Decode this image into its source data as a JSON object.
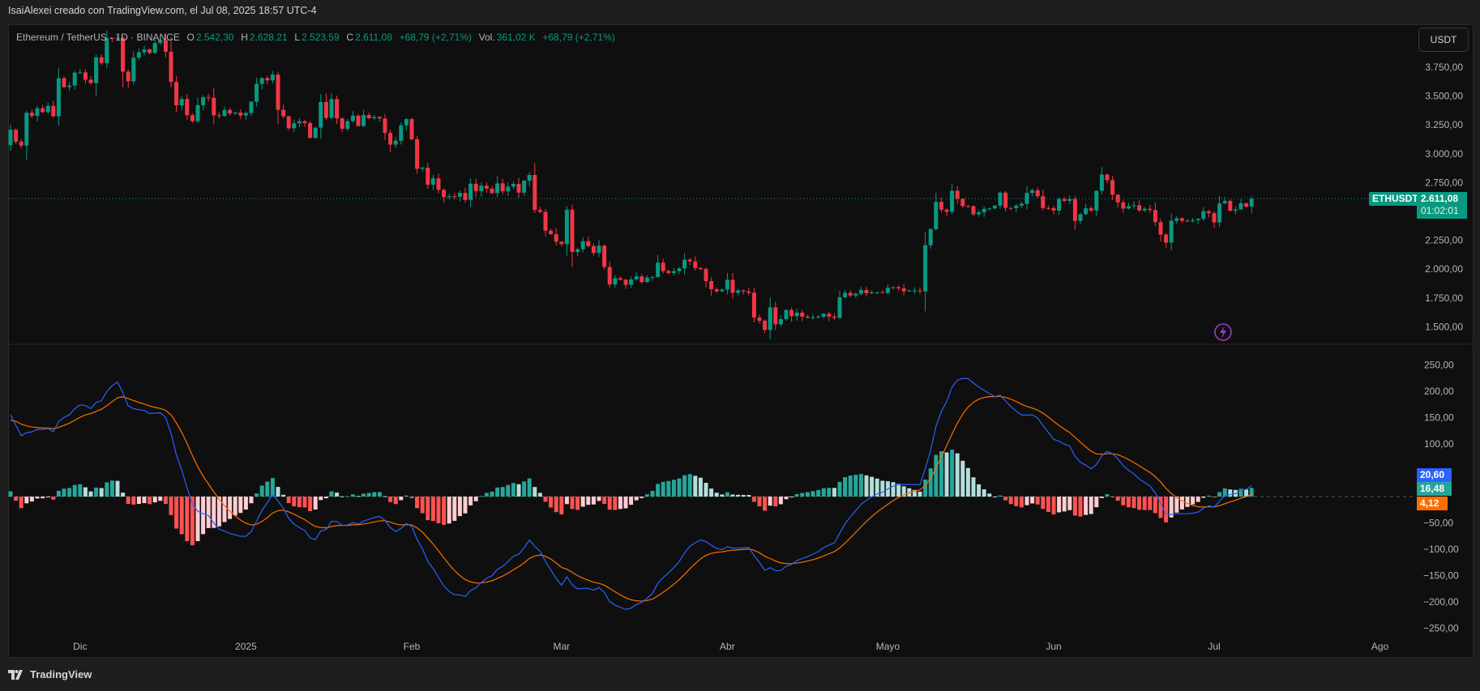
{
  "header": {
    "attribution": "IsaiAlexei creado con TradingView.com, el Jul 08, 2025 18:57 UTC-4"
  },
  "legend": {
    "symbol": "Ethereum / TetherUS · 1D · BINANCE",
    "open_label": "O",
    "open": "2.542,30",
    "high_label": "H",
    "high": "2.628,21",
    "low_label": "L",
    "low": "2.523,59",
    "close_label": "C",
    "close": "2.611,08",
    "change": "+68,79 (+2,71%)",
    "vol_label": "Vol.",
    "volume": "361,02 K",
    "vol_change": "+68,79 (+2,71%)"
  },
  "currency_button": "USDT",
  "price_tag": {
    "symbol": "ETHUSDT",
    "price": "2.611,08",
    "countdown": "01:02:01"
  },
  "macd_tags": {
    "macd": "20,60",
    "histogram": "16,48",
    "signal": "4,12"
  },
  "footer": {
    "brand": "TradingView"
  },
  "colors": {
    "up": "#089981",
    "down": "#f23645",
    "macd": "#2962ff",
    "signal": "#ff6d00",
    "hist_up": "#26a69a",
    "hist_up_fade": "#b2dfdb",
    "hist_down": "#ff5252",
    "hist_down_fade": "#ffcdd2",
    "alert": "#9c3dbf"
  },
  "chart_data": {
    "type": "candlestick",
    "title": "Ethereum / TetherUS · 1D · BINANCE",
    "start_date": "2024-11-18",
    "price_axis": {
      "ticks": [
        "3.750,00",
        "3.500,00",
        "3.250,00",
        "3.000,00",
        "2.750,00",
        "2.250,00",
        "2.000,00",
        "1.750,00",
        "1.500,00"
      ],
      "tick_values": [
        3750,
        3500,
        3250,
        3000,
        2750,
        2250,
        2000,
        1750,
        1500
      ]
    },
    "macd_axis": {
      "ticks": [
        "250,00",
        "200,00",
        "150,00",
        "100,00",
        "-50,00",
        "-100,00",
        "-150,00",
        "-200,00",
        "-250,00"
      ],
      "tick_values": [
        250,
        200,
        150,
        100,
        -50,
        -100,
        -150,
        -200,
        -250
      ]
    },
    "time_axis": [
      {
        "label": "Dic",
        "day": 13
      },
      {
        "label": "2025",
        "day": 44
      },
      {
        "label": "Feb",
        "day": 75
      },
      {
        "label": "Mar",
        "day": 103
      },
      {
        "label": "Abr",
        "day": 134
      },
      {
        "label": "Mayo",
        "day": 164
      },
      {
        "label": "Jun",
        "day": 195
      },
      {
        "label": "Jul",
        "day": 225
      },
      {
        "label": "Ago",
        "day": 256
      }
    ],
    "first_open": 3075,
    "closes": [
      3208,
      3105,
      3071,
      3356,
      3328,
      3395,
      3361,
      3415,
      3325,
      3655,
      3578,
      3591,
      3703,
      3706,
      3642,
      3613,
      3836,
      3786,
      4002,
      3996,
      4004,
      3712,
      3628,
      3833,
      3880,
      3905,
      3874,
      3960,
      3986,
      3884,
      3623,
      3420,
      3475,
      3334,
      3282,
      3421,
      3489,
      3485,
      3333,
      3327,
      3380,
      3349,
      3357,
      3332,
      3353,
      3451,
      3606,
      3656,
      3636,
      3686,
      3381,
      3325,
      3221,
      3264,
      3282,
      3266,
      3138,
      3226,
      3449,
      3311,
      3474,
      3307,
      3216,
      3283,
      3330,
      3241,
      3336,
      3308,
      3319,
      3306,
      3181,
      3079,
      3113,
      3247,
      3300,
      3126,
      2870,
      2880,
      2732,
      2787,
      2687,
      2624,
      2632,
      2627,
      2660,
      2600,
      2740,
      2676,
      2723,
      2697,
      2659,
      2743,
      2674,
      2715,
      2738,
      2663,
      2767,
      2816,
      2513,
      2496,
      2333,
      2303,
      2237,
      2217,
      2515,
      2149,
      2172,
      2242,
      2200,
      2140,
      2203,
      2019,
      1866,
      1921,
      1908,
      1864,
      1911,
      1937,
      1888,
      1926,
      1932,
      2056,
      1983,
      1966,
      1983,
      2006,
      2082,
      2067,
      2010,
      2001,
      1896,
      1826,
      1808,
      1822,
      1907,
      1795,
      1815,
      1806,
      1795,
      1580,
      1553,
      1473,
      1668,
      1522,
      1566,
      1645,
      1592,
      1623,
      1588,
      1578,
      1583,
      1587,
      1613,
      1589,
      1578,
      1756,
      1795,
      1771,
      1786,
      1819,
      1791,
      1799,
      1799,
      1793,
      1838,
      1843,
      1833,
      1808,
      1814,
      1814,
      1808,
      2207,
      2347,
      2583,
      2515,
      2497,
      2680,
      2609,
      2547,
      2545,
      2475,
      2493,
      2522,
      2526,
      2550,
      2663,
      2530,
      2528,
      2550,
      2566,
      2660,
      2683,
      2632,
      2530,
      2529,
      2507,
      2607,
      2591,
      2608,
      2418,
      2476,
      2527,
      2508,
      2679,
      2820,
      2772,
      2645,
      2579,
      2525,
      2546,
      2554,
      2509,
      2523,
      2513,
      2407,
      2299,
      2230,
      2419,
      2440,
      2419,
      2415,
      2424,
      2436,
      2502,
      2485,
      2405,
      2570,
      2591,
      2506,
      2518,
      2571,
      2542,
      2611
    ],
    "last_price": 2611.08,
    "indicator": "MACD (12, 26, 9)"
  }
}
